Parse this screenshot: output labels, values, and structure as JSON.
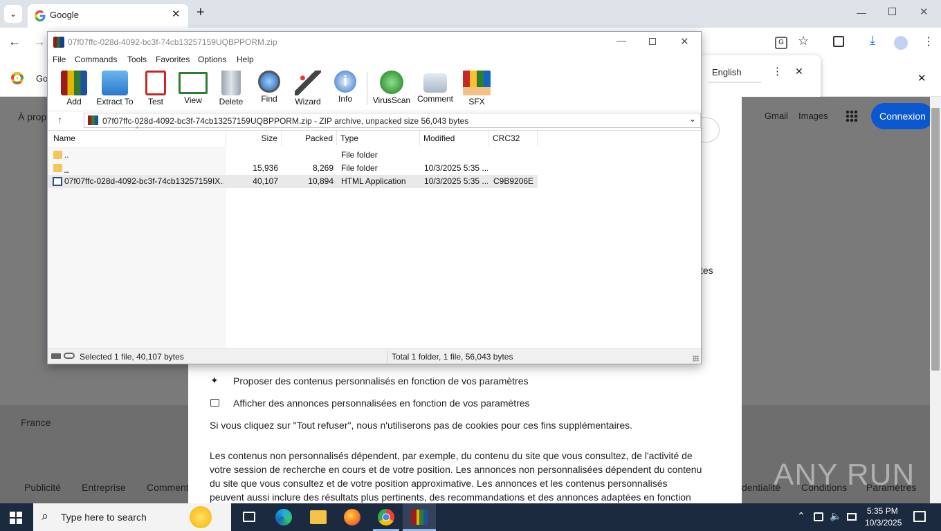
{
  "browser": {
    "tab_title": "Google",
    "new_tab": "+",
    "bookmark_partial": "Go",
    "translate_language": "English",
    "page_left_link": "À propos",
    "page_right_links": [
      "Gmail",
      "Images"
    ],
    "sign_in": "Connexion",
    "partial_right_button": "r",
    "partial_right_text": "tes",
    "footer_country": "France",
    "footer_links": [
      "Publicité",
      "Entreprise",
      "Comment"
    ],
    "footer_right_links": [
      "dentialité",
      "Conditions",
      "Paramètres"
    ]
  },
  "consent": {
    "items": [
      "Proposer des contenus personnalisés en fonction de vos paramètres",
      "Afficher des annonces personnalisées en fonction de vos paramètres"
    ],
    "refuse_note": "Si vous cliquez sur \"Tout refuser\", nous n'utiliserons pas de cookies pour ces fins supplémentaires.",
    "paragraph_lines": [
      "Les contenus non personnalisés dépendent, par exemple, du contenu du site que vous consultez, de l'activité de",
      "votre session de recherche en cours et de votre position. Les annonces non personnalisées dépendent du contenu",
      "du site que vous consultez et de votre position approximative. Les annonces et les contenus personnalisés",
      "peuvent aussi inclure des résultats plus pertinents, des recommandations et des annonces adaptées en fonction"
    ]
  },
  "winrar": {
    "title": "07f07ffc-028d-4092-bc3f-74cb13257159UQBPPORM.zip",
    "menu": [
      "File",
      "Commands",
      "Tools",
      "Favorites",
      "Options",
      "Help"
    ],
    "toolbar": [
      {
        "label": "Add",
        "icon": "add-archive-icon"
      },
      {
        "label": "Extract To",
        "icon": "extract-folder-icon"
      },
      {
        "label": "Test",
        "icon": "test-clipboard-icon"
      },
      {
        "label": "View",
        "icon": "view-book-icon"
      },
      {
        "label": "Delete",
        "icon": "delete-trash-icon"
      },
      {
        "label": "Find",
        "icon": "find-magnifier-icon"
      },
      {
        "label": "Wizard",
        "icon": "wizard-wand-icon"
      },
      {
        "label": "Info",
        "icon": "info-icon"
      },
      {
        "label": "VirusScan",
        "icon": "virusscan-icon"
      },
      {
        "label": "Comment",
        "icon": "comment-icon"
      },
      {
        "label": "SFX",
        "icon": "sfx-box-icon"
      }
    ],
    "address": "07f07ffc-028d-4092-bc3f-74cb13257159UQBPPORM.zip - ZIP archive, unpacked size 56,043 bytes",
    "columns": [
      "Name",
      "Size",
      "Packed",
      "Type",
      "Modified",
      "CRC32"
    ],
    "rows": [
      {
        "name": "..",
        "size": "",
        "packed": "",
        "type": "File folder",
        "modified": "",
        "crc": ""
      },
      {
        "name": "_",
        "size": "15,936",
        "packed": "8,269",
        "type": "File folder",
        "modified": "10/3/2025 5:35 ...",
        "crc": ""
      },
      {
        "name": "07f07ffc-028d-4092-bc3f-74cb13257159IX...",
        "size": "40,107",
        "packed": "10,894",
        "type": "HTML Application",
        "modified": "10/3/2025 5:35 ...",
        "crc": "C9B9206E"
      }
    ],
    "status_left": "Selected 1 file, 40,107 bytes",
    "status_right": "Total 1 folder, 1 file, 56,043 bytes"
  },
  "taskbar": {
    "search_placeholder": "Type here to search",
    "time": "5:35 PM",
    "date": "10/3/2025",
    "watermark": "ANY RUN"
  }
}
